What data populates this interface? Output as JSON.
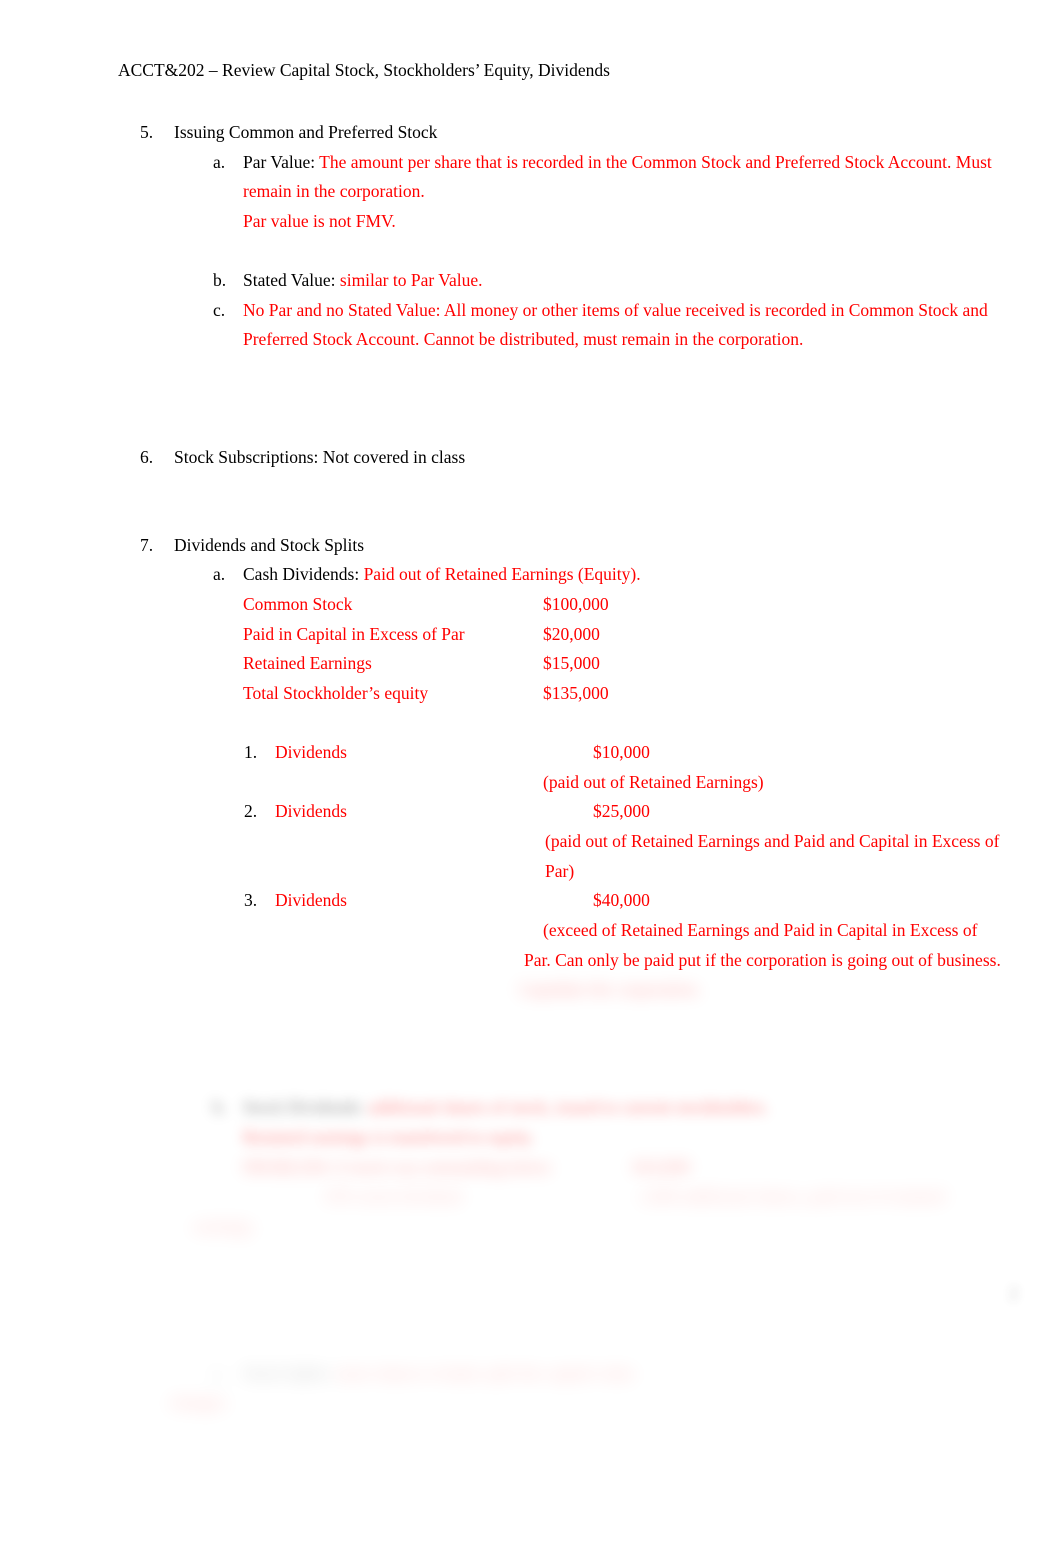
{
  "document": {
    "header": "ACCT&202 – Review Capital Stock, Stockholders’ Equity, Dividends",
    "page_number": "2"
  },
  "sections": [
    {
      "marker": "5.",
      "title": "Issuing Common and Preferred Stock",
      "items": [
        {
          "marker": "a.",
          "label": "Par Value:",
          "answer_line1": "The amount per share that is recorded in the Common Stock and Preferred Stock Account. Must",
          "answer_line2": "remain in the corporation.",
          "answer_line3": "Par value is not FMV."
        },
        {
          "marker": "b.",
          "label": "Stated Value:",
          "answer_line1": "similar to Par Value."
        },
        {
          "marker": "c.",
          "answer_line1": "No Par and no Stated Value: All money or other items of value received is recorded in Common Stock and",
          "answer_line2": "Preferred Stock Account. Cannot be distributed, must remain in the corporation."
        }
      ]
    },
    {
      "marker": "6.",
      "title": "Stock Subscriptions: Not covered in class"
    },
    {
      "marker": "7.",
      "title": "Dividends and Stock Splits",
      "cash_dividends": {
        "marker": "a.",
        "label": "Cash Dividends:",
        "answer": "Paid out of Retained Earnings (Equity).",
        "equity_table": {
          "rows": [
            {
              "account": "Common Stock",
              "amount": "$100,000"
            },
            {
              "account": "Paid in Capital in Excess of Par",
              "amount": "$20,000"
            },
            {
              "account": "Retained Earnings",
              "amount": "$15,000"
            },
            {
              "account": "Total Stockholder’s equity",
              "amount": "$135,000"
            }
          ]
        },
        "scenarios": [
          {
            "marker": "1.",
            "label": "Dividends",
            "amount": "$10,000",
            "note_line1": "(paid out of Retained Earnings)"
          },
          {
            "marker": "2.",
            "label": "Dividends",
            "amount": "$25,000",
            "note_line1": "(paid out of Retained Earnings and Paid and Capital in Excess of",
            "note_line2": "Par)"
          },
          {
            "marker": "3.",
            "label": "Dividends",
            "amount": "$40,000",
            "note_line1": "(exceed of Retained Earnings and Paid in Capital in Excess of",
            "note_line2": "Par. Can only be paid put if the corporation is going out of business.",
            "note_line3": "Liquidate the corporation."
          }
        ]
      },
      "stock_dividends": {
        "marker": "b.",
        "label": "Stock Dividends:",
        "answer_line1": "additional shares of stock, issued to current stockholders.",
        "answer_line2": "Retained earnings is transferred to equity.",
        "answer_line3": "PROBLEM: if stock was outstanding below",
        "answer_line3_amount": "$10,000",
        "answer_line4_label": "10% stock dividend",
        "answer_line4": "1,000 additional shares, paid out of retained",
        "answer_line5": "earnings."
      },
      "stock_splits": {
        "marker": "c.",
        "label": "Stock Splits:",
        "answer_line1": "more shares to hand, split the capital value",
        "answer_line2": "changes."
      }
    }
  ]
}
